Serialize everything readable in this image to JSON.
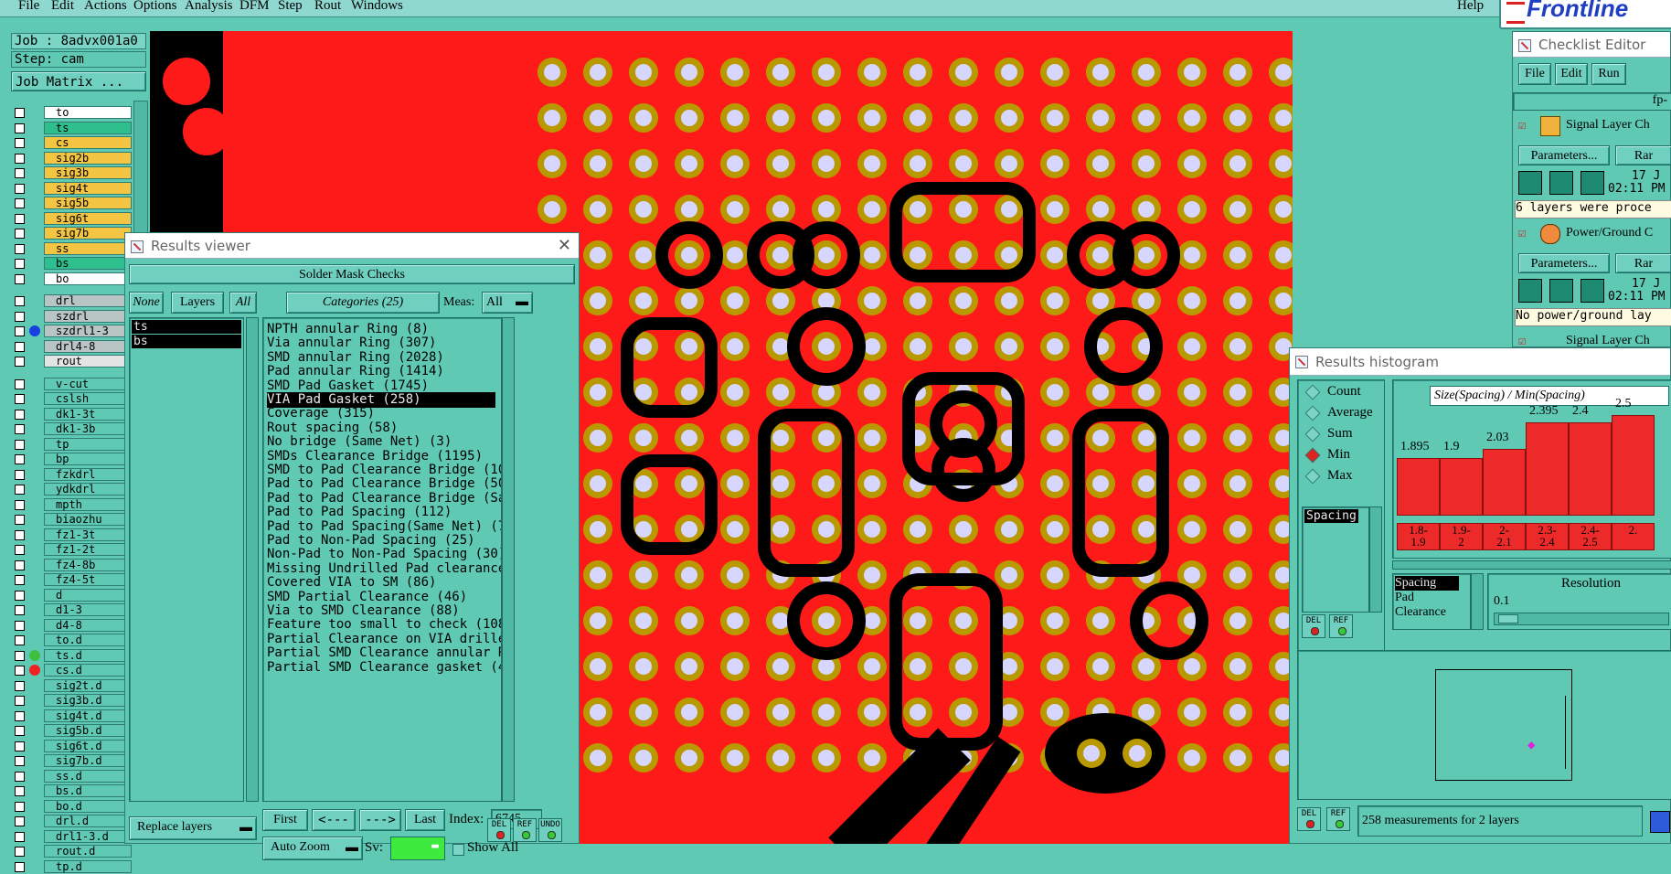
{
  "menubar": {
    "items": [
      "File",
      "Edit",
      "Actions",
      "Options",
      "Analysis",
      "DFM",
      "Step",
      "Rout",
      "Windows"
    ],
    "help": "Help",
    "logo": "Frontline"
  },
  "left": {
    "job": "Job : 8advx001a0",
    "step": "Step: cam",
    "job_matrix": "Job Matrix ...",
    "group1": [
      {
        "n": "to",
        "c": "#ffffff"
      },
      {
        "n": "ts",
        "c": "#2fbf8f"
      },
      {
        "n": "cs",
        "c": "#f4c542"
      },
      {
        "n": "sig2b",
        "c": "#f4c542"
      },
      {
        "n": "sig3b",
        "c": "#f4c542"
      },
      {
        "n": "sig4t",
        "c": "#f4c542"
      },
      {
        "n": "sig5b",
        "c": "#f4c542"
      },
      {
        "n": "sig6t",
        "c": "#f4c542"
      },
      {
        "n": "sig7b",
        "c": "#f4c542"
      },
      {
        "n": "ss",
        "c": "#f4c542"
      },
      {
        "n": "bs",
        "c": "#2fbf8f"
      },
      {
        "n": "bo",
        "c": "#ffffff"
      }
    ],
    "group2": [
      {
        "n": "drl",
        "c": "#b9c4c4"
      },
      {
        "n": "szdrl",
        "c": "#b9c4c4"
      },
      {
        "n": "szdrl1-3",
        "c": "#b9c4c4"
      },
      {
        "n": "drl4-8",
        "c": "#b9c4c4"
      },
      {
        "n": "rout",
        "c": "#e4e4e4"
      }
    ],
    "group3": [
      "v-cut",
      "cslsh",
      "dk1-3t",
      "dk1-3b",
      "tp",
      "bp",
      "fzkdrl",
      "ydkdrl",
      "mpth",
      "biaozhu",
      "fz1-3t",
      "fz1-2t",
      "fz4-8b",
      "fz4-5t",
      "d",
      "d1-3",
      "d4-8",
      "to.d",
      "ts.d",
      "cs.d",
      "sig2t.d",
      "sig3b.d",
      "sig4t.d",
      "sig5b.d",
      "sig6t.d",
      "sig7b.d",
      "ss.d",
      "bs.d",
      "bo.d",
      "drl.d",
      "drl1-3.d",
      "rout.d",
      "tp.d"
    ]
  },
  "results_viewer": {
    "title": "Results viewer",
    "header": "Solder Mask Checks",
    "none": "None",
    "layers": "Layers",
    "all": "All",
    "categories": "Categories (25)",
    "meas": "Meas:",
    "meas_value": "All",
    "layer_list": [
      "ts",
      "bs"
    ],
    "items": [
      "NPTH annular Ring (8)",
      "Via annular Ring (307)",
      "SMD annular Ring (2028)",
      "Pad annular Ring (1414)",
      "SMD Pad Gasket (1745)",
      "VIA Pad Gasket (258)",
      "Coverage (315)",
      "Rout spacing (58)",
      "No bridge (Same Net) (3)",
      "SMDs Clearance Bridge (1195)",
      "SMD to Pad Clearance Bridge (1062",
      "Pad to Pad Clearance Bridge (50)",
      "Pad to Pad Clearance Bridge (Same",
      "Pad to Pad Spacing (112)",
      "Pad to Pad Spacing(Same Net) (7)",
      "Pad to Non-Pad Spacing (25)",
      "Non-Pad to Non-Pad Spacing (30)",
      "Missing Undrilled Pad clearance (",
      "Covered VIA to SM (86)",
      "SMD Partial Clearance (46)",
      "Via to SMD Clearance (88)",
      "Feature too small to check (108)",
      "Partial Clearance on VIA drilled",
      "Partial SMD Clearance annular Rir",
      "Partial SMD Clearance gasket (46)"
    ],
    "selected_index": 5,
    "first": "First",
    "prev": "<---",
    "next": "--->",
    "last": "Last",
    "index_label": "Index:",
    "index_value": "6745",
    "auto_zoom": "Auto Zoom",
    "sv": "Sv:",
    "show_all": "Show All",
    "replace_layers": "Replace layers",
    "del": "DEL",
    "ref": "REF",
    "undo": "UNDO"
  },
  "checklist": {
    "title": "Checklist Editor",
    "menu": [
      "File",
      "Edit",
      "Run"
    ],
    "fp": "fp-",
    "item1": "Signal Layer Ch",
    "params": "Parameters...",
    "run": "Rar",
    "date": "17 J",
    "time": "02:11 PM",
    "msg1": "6 layers were proce",
    "item2": "Power/Ground C",
    "msg2": "No power/ground lay",
    "item3": "Signal Layer Ch"
  },
  "histogram": {
    "title": "Results histogram",
    "options": [
      "Count",
      "Average",
      "Sum",
      "Min",
      "Max"
    ],
    "selected": "Min",
    "list_top": "Spacing",
    "chart_title": "Size(Spacing) / Min(Spacing)",
    "bars": [
      {
        "label": "1.8-\n1.9",
        "value": 1.895
      },
      {
        "label": "1.9-\n2",
        "value": 1.9
      },
      {
        "label": "2-\n2.1",
        "value": 2.03
      },
      {
        "label": "2.3-\n2.4",
        "value": 2.395
      },
      {
        "label": "2.4-\n2.5",
        "value": 2.4
      },
      {
        "label": "2.",
        "value": 2.5
      }
    ],
    "list_bottom": [
      "Spacing",
      "Pad",
      "Clearance"
    ],
    "resolution": "Resolution",
    "resolution_value": "0.1",
    "status": "258 measurements for 2 layers",
    "del": "DEL",
    "ref": "REF"
  }
}
